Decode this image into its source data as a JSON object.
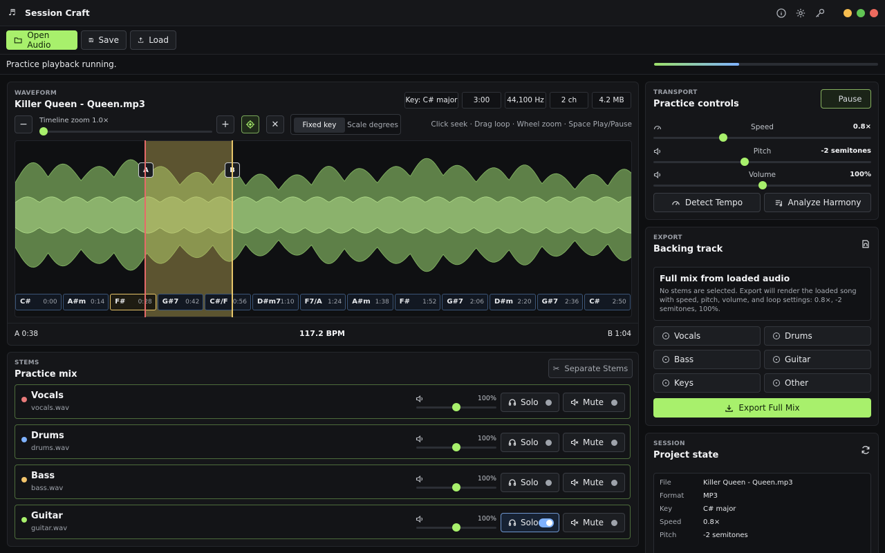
{
  "app": {
    "title": "Session Craft"
  },
  "toolbar": {
    "open_label": "Open Audio",
    "save_label": "Save",
    "load_label": "Load"
  },
  "status": {
    "message": "Practice playback running.",
    "progress": 0.38
  },
  "waveform": {
    "eyebrow": "WAVEFORM",
    "track_title": "Killer Queen - Queen.mp3",
    "meta": [
      "Key: C# major",
      "3:00",
      "44,100 Hz",
      "2 ch",
      "4.2 MB"
    ],
    "zoom_label": "Timeline zoom 1.0×",
    "key_modes": [
      "Fixed key",
      "Scale degrees"
    ],
    "active_key_mode": "Fixed key",
    "hint": "Click seek · Drag loop · Wheel zoom · Space Play/Pause",
    "marker_a": "A",
    "marker_b": "B",
    "loop_a_label": "A 0:38",
    "loop_b_label": "B 1:04",
    "bpm_label": "117.2 BPM",
    "chords": [
      {
        "name": "C#",
        "time": "0:00"
      },
      {
        "name": "A#m",
        "time": "0:14"
      },
      {
        "name": "F#",
        "time": "0:28"
      },
      {
        "name": "G#7",
        "time": "0:42"
      },
      {
        "name": "C#/F",
        "time": "0:56"
      },
      {
        "name": "D#m7",
        "time": "1:10"
      },
      {
        "name": "F7/A",
        "time": "1:24"
      },
      {
        "name": "A#m",
        "time": "1:38"
      },
      {
        "name": "F#",
        "time": "1:52"
      },
      {
        "name": "G#7",
        "time": "2:06"
      },
      {
        "name": "D#m",
        "time": "2:20"
      },
      {
        "name": "G#7",
        "time": "2:36"
      },
      {
        "name": "C#",
        "time": "2:50"
      }
    ],
    "current_chord_index": 2,
    "colors": {
      "wave": "#8fc56a",
      "loop": "#c9b25a",
      "playhead": "#e56a6a"
    }
  },
  "stems": {
    "eyebrow": "STEMS",
    "title": "Practice mix",
    "separate_label": "Separate Stems",
    "solo_label": "Solo",
    "mute_label": "Mute",
    "items": [
      {
        "name": "Vocals",
        "file": "vocals.wav",
        "volume": "100%",
        "color": "#e87a7a",
        "solo": false
      },
      {
        "name": "Drums",
        "file": "drums.wav",
        "volume": "100%",
        "color": "#7fb2ff",
        "solo": false
      },
      {
        "name": "Bass",
        "file": "bass.wav",
        "volume": "100%",
        "color": "#f2c46b",
        "solo": false
      },
      {
        "name": "Guitar",
        "file": "guitar.wav",
        "volume": "100%",
        "color": "#a8f06c",
        "solo": true
      }
    ]
  },
  "transport": {
    "eyebrow": "TRANSPORT",
    "title": "Practice controls",
    "pause_label": "Pause",
    "sliders": [
      {
        "label": "Speed",
        "value": "0.8×",
        "level": 0.32
      },
      {
        "label": "Pitch",
        "value": "-2 semitones",
        "level": 0.42
      },
      {
        "label": "Volume",
        "value": "100%",
        "level": 0.5
      }
    ],
    "detect_tempo_label": "Detect Tempo",
    "analyze_label": "Analyze Harmony"
  },
  "export": {
    "eyebrow": "EXPORT",
    "title": "Backing track",
    "mix_title": "Full mix from loaded audio",
    "mix_desc": "No stems are selected. Export will render the loaded song with speed, pitch, volume, and loop settings: 0.8×, -2 semitones, 100%.",
    "stem_options": [
      "Vocals",
      "Drums",
      "Bass",
      "Guitar",
      "Keys",
      "Other"
    ],
    "export_label": "Export Full Mix"
  },
  "session": {
    "eyebrow": "SESSION",
    "title": "Project state",
    "rows": [
      {
        "key": "File",
        "value": "Killer Queen - Queen.mp3"
      },
      {
        "key": "Format",
        "value": "MP3"
      },
      {
        "key": "Key",
        "value": "C# major"
      },
      {
        "key": "Speed",
        "value": "0.8×"
      },
      {
        "key": "Pitch",
        "value": "-2 semitones"
      }
    ]
  }
}
